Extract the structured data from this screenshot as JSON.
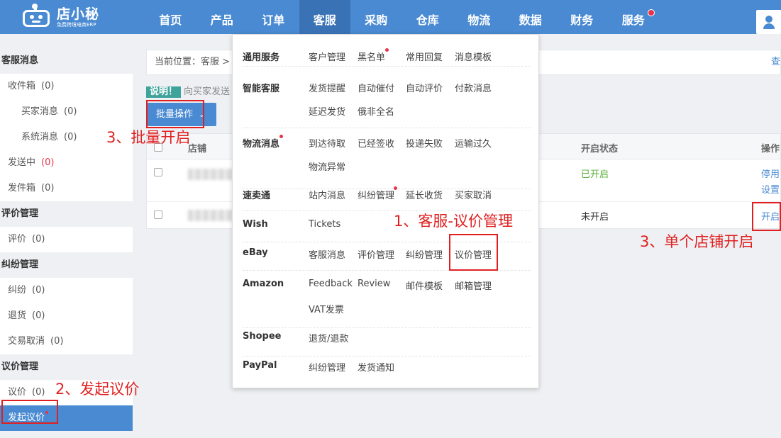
{
  "logo": {
    "name": "店小秘",
    "tagline": "免费跨境电商ERP"
  },
  "nav": {
    "items": [
      "首页",
      "产品",
      "订单",
      "客服",
      "采购",
      "仓库",
      "物流",
      "数据",
      "财务",
      "服务"
    ],
    "active": "客服"
  },
  "sidebar": {
    "inbox_group": "客服消息",
    "inbox": "收件箱",
    "inbox_count": "(0)",
    "buyer_msgs": "买家消息",
    "buyer_count": "(0)",
    "system_msgs": "系统消息",
    "system_count": "(0)",
    "sending": "发送中",
    "sending_count": "(0)",
    "outbox": "发件箱",
    "outbox_count": "(0)",
    "review_group": "评价管理",
    "reviews": "评价",
    "reviews_count": "(0)",
    "dispute_group": "纠纷管理",
    "disputes": "纠纷",
    "disputes_count": "(0)",
    "returns": "退货",
    "returns_count": "(0)",
    "cancel": "交易取消",
    "cancel_count": "(0)",
    "offer_group": "议价管理",
    "offers": "议价",
    "offers_count": "(0)",
    "start_offer": "发起议价"
  },
  "breadcrumb": {
    "prefix": "当前位置：",
    "path": "客服 > e",
    "right": "查"
  },
  "note": {
    "tag": "说明！",
    "text": "向买家发送"
  },
  "batch_button": "批量操作",
  "table": {
    "headers": {
      "store": "店铺",
      "status": "开启状态",
      "ops": "操作"
    },
    "rows": [
      {
        "status": "已开启",
        "actions": [
          "停用",
          "设置"
        ]
      },
      {
        "status": "未开启",
        "actions": [
          "开启"
        ]
      }
    ]
  },
  "dropdown": {
    "general": {
      "label": "通用服务",
      "links": [
        "客户管理",
        "黑名单",
        "常用回复",
        "消息模板"
      ]
    },
    "smart": {
      "label": "智能客服",
      "links": [
        "发货提醒",
        "自动催付",
        "自动评价",
        "付款消息",
        "延迟发货",
        "俄非全名"
      ]
    },
    "logistics": {
      "label": "物流消息",
      "links": [
        "到达待取",
        "已经签收",
        "投递失败",
        "运输过久",
        "物流异常"
      ]
    },
    "aliexpress": {
      "label": "速卖通",
      "links": [
        "站内消息",
        "纠纷管理",
        "延长收货",
        "买家取消"
      ]
    },
    "wish": {
      "label": "Wish",
      "links": [
        "Tickets"
      ]
    },
    "ebay": {
      "label": "eBay",
      "links": [
        "客服消息",
        "评价管理",
        "纠纷管理",
        "议价管理"
      ]
    },
    "amazon": {
      "label": "Amazon",
      "links": [
        "Feedback",
        "Review",
        "邮件模板",
        "邮箱管理",
        "VAT发票"
      ]
    },
    "shopee": {
      "label": "Shopee",
      "links": [
        "退货/退款"
      ]
    },
    "paypal": {
      "label": "PayPal",
      "links": [
        "纠纷管理",
        "发货通知"
      ]
    }
  },
  "annotations": {
    "step1": "1、客服-议价管理",
    "step2": "2、发起议价",
    "step3_batch": "3、批量开启",
    "step3_single": "3、单个店铺开启"
  },
  "colors": {
    "primary": "#4a8ad2",
    "annotation": "#e02020",
    "enabled": "#5ab13d",
    "badge": "#e8334a"
  }
}
